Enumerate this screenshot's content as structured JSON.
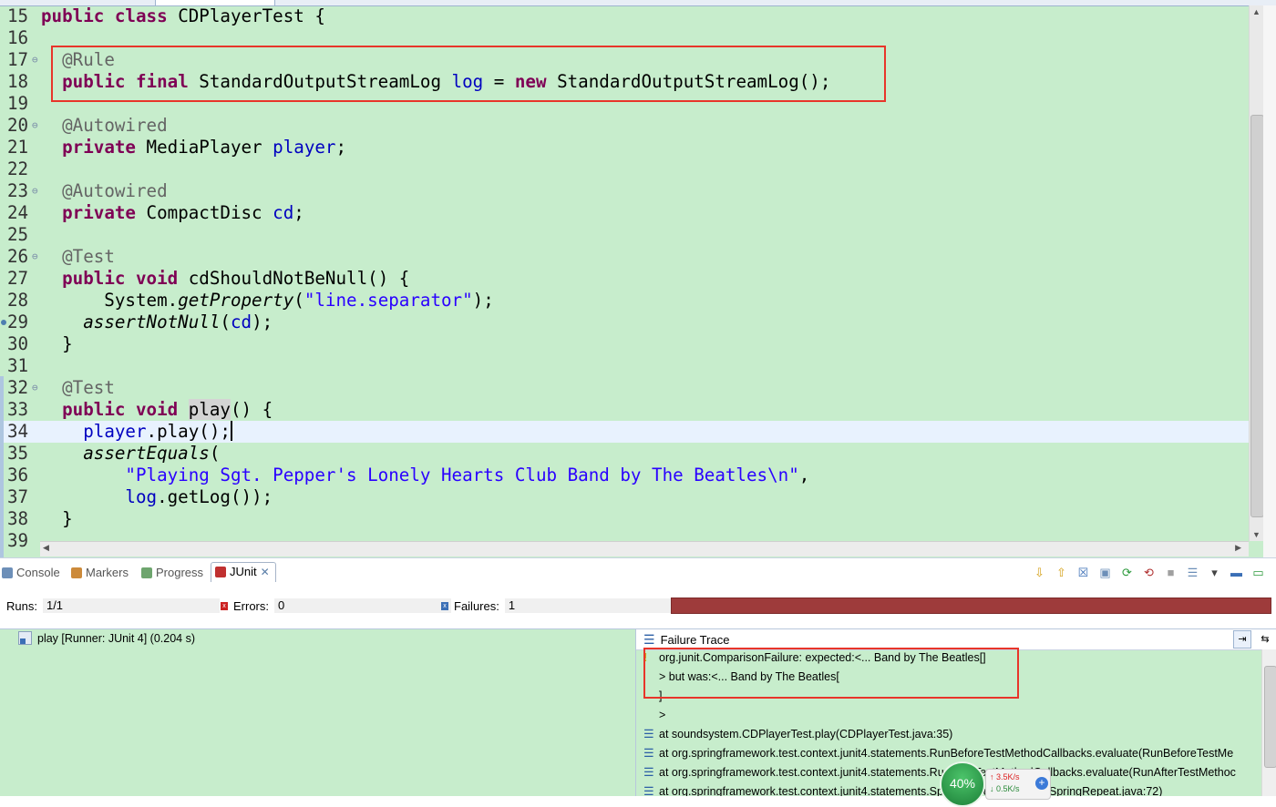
{
  "editor": {
    "lines": [
      {
        "n": "15",
        "fold": "",
        "dot": false,
        "current": false,
        "tokens": [
          {
            "c": "kw",
            "t": "public"
          },
          {
            "c": "",
            "t": " "
          },
          {
            "c": "kw",
            "t": "class"
          },
          {
            "c": "",
            "t": " CDPlayerTest {"
          }
        ]
      },
      {
        "n": "16",
        "fold": "",
        "dot": false,
        "current": false,
        "tokens": []
      },
      {
        "n": "17",
        "fold": "⊖",
        "dot": false,
        "current": false,
        "tokens": [
          {
            "c": "",
            "t": "  "
          },
          {
            "c": "ann",
            "t": "@Rule"
          }
        ]
      },
      {
        "n": "18",
        "fold": "",
        "dot": false,
        "current": false,
        "tokens": [
          {
            "c": "",
            "t": "  "
          },
          {
            "c": "kw",
            "t": "public"
          },
          {
            "c": "",
            "t": " "
          },
          {
            "c": "kw",
            "t": "final"
          },
          {
            "c": "",
            "t": " StandardOutputStreamLog "
          },
          {
            "c": "fld",
            "t": "log"
          },
          {
            "c": "",
            "t": " = "
          },
          {
            "c": "kw",
            "t": "new"
          },
          {
            "c": "",
            "t": " StandardOutputStreamLog();"
          }
        ]
      },
      {
        "n": "19",
        "fold": "",
        "dot": false,
        "current": false,
        "tokens": []
      },
      {
        "n": "20",
        "fold": "⊖",
        "dot": false,
        "current": false,
        "tokens": [
          {
            "c": "",
            "t": "  "
          },
          {
            "c": "ann",
            "t": "@Autowired"
          }
        ]
      },
      {
        "n": "21",
        "fold": "",
        "dot": false,
        "current": false,
        "tokens": [
          {
            "c": "",
            "t": "  "
          },
          {
            "c": "kw",
            "t": "private"
          },
          {
            "c": "",
            "t": " MediaPlayer "
          },
          {
            "c": "fld",
            "t": "player"
          },
          {
            "c": "",
            "t": ";"
          }
        ]
      },
      {
        "n": "22",
        "fold": "",
        "dot": false,
        "current": false,
        "tokens": []
      },
      {
        "n": "23",
        "fold": "⊖",
        "dot": false,
        "current": false,
        "tokens": [
          {
            "c": "",
            "t": "  "
          },
          {
            "c": "ann",
            "t": "@Autowired"
          }
        ]
      },
      {
        "n": "24",
        "fold": "",
        "dot": false,
        "current": false,
        "tokens": [
          {
            "c": "",
            "t": "  "
          },
          {
            "c": "kw",
            "t": "private"
          },
          {
            "c": "",
            "t": " CompactDisc "
          },
          {
            "c": "fld",
            "t": "cd"
          },
          {
            "c": "",
            "t": ";"
          }
        ]
      },
      {
        "n": "25",
        "fold": "",
        "dot": false,
        "current": false,
        "tokens": []
      },
      {
        "n": "26",
        "fold": "⊖",
        "dot": false,
        "current": false,
        "tokens": [
          {
            "c": "",
            "t": "  "
          },
          {
            "c": "ann",
            "t": "@Test"
          }
        ]
      },
      {
        "n": "27",
        "fold": "",
        "dot": false,
        "current": false,
        "tokens": [
          {
            "c": "",
            "t": "  "
          },
          {
            "c": "kw",
            "t": "public"
          },
          {
            "c": "",
            "t": " "
          },
          {
            "c": "kw",
            "t": "void"
          },
          {
            "c": "",
            "t": " cdShouldNotBeNull() {"
          }
        ]
      },
      {
        "n": "28",
        "fold": "",
        "dot": false,
        "current": false,
        "tokens": [
          {
            "c": "",
            "t": "      System."
          },
          {
            "c": "it",
            "t": "getProperty"
          },
          {
            "c": "",
            "t": "("
          },
          {
            "c": "str",
            "t": "\"line.separator\""
          },
          {
            "c": "",
            "t": ");"
          }
        ]
      },
      {
        "n": "29",
        "fold": "",
        "dot": true,
        "current": false,
        "tokens": [
          {
            "c": "",
            "t": "    "
          },
          {
            "c": "it",
            "t": "assertNotNull"
          },
          {
            "c": "",
            "t": "("
          },
          {
            "c": "fld",
            "t": "cd"
          },
          {
            "c": "",
            "t": ");"
          }
        ]
      },
      {
        "n": "30",
        "fold": "",
        "dot": false,
        "current": false,
        "tokens": [
          {
            "c": "",
            "t": "  }"
          }
        ]
      },
      {
        "n": "31",
        "fold": "",
        "dot": false,
        "current": false,
        "tokens": []
      },
      {
        "n": "32",
        "fold": "⊖",
        "dot": false,
        "current": false,
        "tokens": [
          {
            "c": "",
            "t": "  "
          },
          {
            "c": "ann",
            "t": "@Test"
          }
        ]
      },
      {
        "n": "33",
        "fold": "",
        "dot": false,
        "current": false,
        "tokens": [
          {
            "c": "",
            "t": "  "
          },
          {
            "c": "kw",
            "t": "public"
          },
          {
            "c": "",
            "t": " "
          },
          {
            "c": "kw",
            "t": "void"
          },
          {
            "c": "",
            "t": " "
          },
          {
            "c": "hl",
            "t": "play"
          },
          {
            "c": "",
            "t": "() {"
          }
        ]
      },
      {
        "n": "34",
        "fold": "",
        "dot": false,
        "current": true,
        "tokens": [
          {
            "c": "",
            "t": "    "
          },
          {
            "c": "fld",
            "t": "player"
          },
          {
            "c": "",
            "t": ".play();"
          },
          {
            "c": "caret",
            "t": ""
          }
        ]
      },
      {
        "n": "35",
        "fold": "",
        "dot": false,
        "current": false,
        "tokens": [
          {
            "c": "",
            "t": "    "
          },
          {
            "c": "it",
            "t": "assertEquals"
          },
          {
            "c": "",
            "t": "("
          }
        ]
      },
      {
        "n": "36",
        "fold": "",
        "dot": false,
        "current": false,
        "tokens": [
          {
            "c": "",
            "t": "        "
          },
          {
            "c": "str",
            "t": "\"Playing Sgt. Pepper's Lonely Hearts Club Band by The Beatles\\n\""
          },
          {
            "c": "",
            "t": ","
          }
        ]
      },
      {
        "n": "37",
        "fold": "",
        "dot": false,
        "current": false,
        "tokens": [
          {
            "c": "",
            "t": "        "
          },
          {
            "c": "fld",
            "t": "log"
          },
          {
            "c": "",
            "t": ".getLog());"
          }
        ]
      },
      {
        "n": "38",
        "fold": "",
        "dot": false,
        "current": false,
        "tokens": [
          {
            "c": "",
            "t": "  }"
          }
        ]
      },
      {
        "n": "39",
        "fold": "",
        "dot": false,
        "current": false,
        "tokens": []
      }
    ]
  },
  "views": {
    "tabs": {
      "console": "Console",
      "markers": "Markers",
      "progress": "Progress",
      "junit": "JUnit"
    },
    "colors": {
      "console": "#6d8fb8",
      "markers": "#cc8a3a",
      "progress": "#6ea56e",
      "junit": "#c03030"
    }
  },
  "junit": {
    "runs_label": "Runs:",
    "runs_value": "1/1",
    "errors_label": "Errors:",
    "errors_value": "0",
    "failures_label": "Failures:",
    "failures_value": "1",
    "bar_color": "#9e3b3b",
    "test_item": "play [Runner: JUnit 4] (0.204 s)",
    "trace_title": "Failure Trace",
    "trace_lines": [
      {
        "icon": "warn",
        "text": "org.junit.ComparisonFailure: expected:<... Band by The Beatles[]"
      },
      {
        "icon": "",
        "text": "> but was:<... Band by The Beatles["
      },
      {
        "icon": "",
        "text": "]"
      },
      {
        "icon": "",
        "text": ">"
      },
      {
        "icon": "stack",
        "text": "at soundsystem.CDPlayerTest.play(CDPlayerTest.java:35)"
      },
      {
        "icon": "stack",
        "text": "at org.springframework.test.context.junit4.statements.RunBeforeTestMethodCallbacks.evaluate(RunBeforeTestMe"
      },
      {
        "icon": "stack",
        "text": "at org.springframework.test.context.junit4.statements.RunAfterTestMethodCallbacks.evaluate(RunAfterTestMethoc"
      },
      {
        "icon": "stack",
        "text": "at org.springframework.test.context.junit4.statements.SpringRepeat.evaluate(SpringRepeat.java:72)"
      }
    ]
  },
  "net_widget": {
    "percent": "40%",
    "up": "3.5K/s",
    "down": "0.5K/s"
  }
}
